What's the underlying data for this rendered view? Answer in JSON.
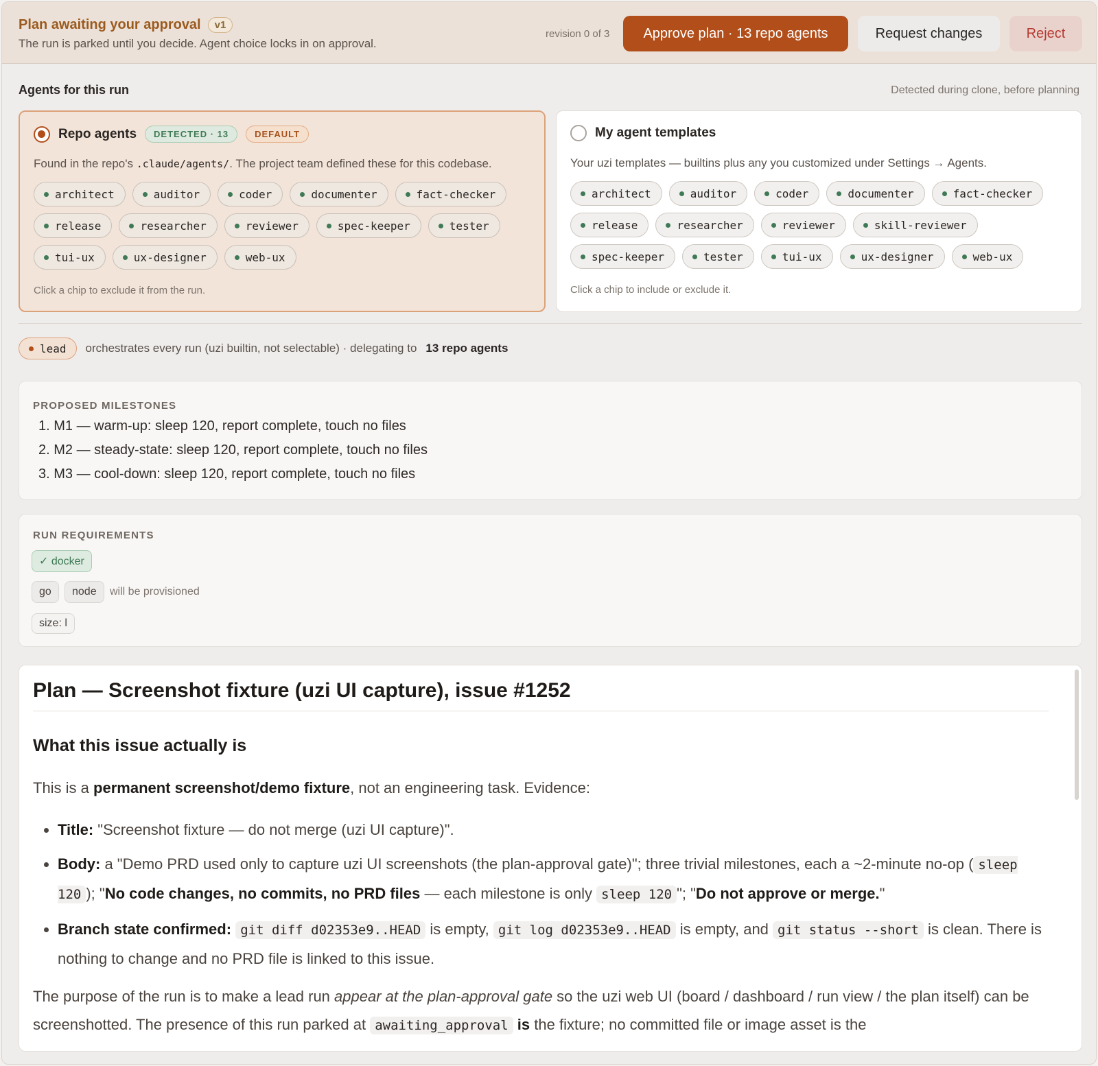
{
  "header": {
    "title": "Plan awaiting your approval",
    "version": "v1",
    "subtitle": "The run is parked until you decide. Agent choice locks in on approval.",
    "revision": "revision 0 of 3",
    "approve_label": "Approve plan · 13 repo agents",
    "changes_label": "Request changes",
    "reject_label": "Reject"
  },
  "agents": {
    "title": "Agents for this run",
    "note": "Detected during clone, before planning",
    "repo": {
      "name": "Repo agents",
      "detected": "DETECTED · 13",
      "default": "DEFAULT",
      "desc_before": "Found in the repo's ",
      "desc_code": ".claude/agents/",
      "desc_after": ". The project team defined these for this codebase.",
      "chips": [
        "architect",
        "auditor",
        "coder",
        "documenter",
        "fact-checker",
        "release",
        "researcher",
        "reviewer",
        "spec-keeper",
        "tester",
        "tui-ux",
        "ux-designer",
        "web-ux"
      ],
      "hint": "Click a chip to exclude it from the run."
    },
    "templates": {
      "name": "My agent templates",
      "desc": "Your uzi templates — builtins plus any you customized under Settings → Agents.",
      "chips": [
        "architect",
        "auditor",
        "coder",
        "documenter",
        "fact-checker",
        "release",
        "researcher",
        "reviewer",
        "skill-reviewer",
        "spec-keeper",
        "tester",
        "tui-ux",
        "ux-designer",
        "web-ux"
      ],
      "hint": "Click a chip to include or exclude it."
    }
  },
  "lead": {
    "chip": "lead",
    "text": "orchestrates every run (uzi builtin, not selectable) · delegating to",
    "target": "13 repo agents"
  },
  "milestones": {
    "label": "PROPOSED MILESTONES",
    "items": [
      "1. M1 — warm-up: sleep 120, report complete, touch no files",
      "2. M2 — steady-state: sleep 120, report complete, touch no files",
      "3. M3 — cool-down: sleep 120, report complete, touch no files"
    ]
  },
  "requirements": {
    "label": "RUN REQUIREMENTS",
    "ok": "✓ docker",
    "go": "go",
    "node": "node",
    "provision_note": "will be provisioned",
    "size": "size: l"
  },
  "plan": {
    "title": "Plan — Screenshot fixture (uzi UI capture), issue #1252",
    "h2": "What this issue actually is",
    "intro_before": "This is a ",
    "intro_bold": "permanent screenshot/demo fixture",
    "intro_after": ", not an engineering task. Evidence:",
    "b1_label": "Title:",
    "b1_text": " \"Screenshot fixture — do not merge (uzi UI capture)\".",
    "b2_label": "Body:",
    "b2_text1": " a \"Demo PRD used only to capture uzi UI screenshots (the plan-approval gate)\"; three trivial milestones, each a ~2-minute no-op (",
    "b2_code1": "sleep 120",
    "b2_text2": "); \"",
    "b2_bold1": "No code changes, no commits, no PRD files",
    "b2_text3": " — each milestone is only ",
    "b2_code2": "sleep 120",
    "b2_text4": "\"; \"",
    "b2_bold2": "Do not approve or merge.",
    "b2_text5": "\"",
    "b3_label": "Branch state confirmed:",
    "b3_code1": "git diff d02353e9..HEAD",
    "b3_text1": " is empty, ",
    "b3_code2": "git log d02353e9..HEAD",
    "b3_text2": " is empty, and ",
    "b3_code3": "git status --short",
    "b3_text3": " is clean. There is nothing to change and no PRD file is linked to this issue.",
    "p2_text1": "The purpose of the run is to make a lead run ",
    "p2_italic": "appear at the plan-approval gate",
    "p2_text2": " so the uzi web UI (board / dashboard / run view / the plan itself) can be screenshotted. The presence of this run parked at ",
    "p2_code": "awaiting_approval",
    "p2_bold": " is",
    "p2_text3": " the fixture; no committed file or image asset is the"
  },
  "colors": {
    "accent": "#b24e1a",
    "success": "#3f7a56",
    "danger": "#b63a32"
  }
}
